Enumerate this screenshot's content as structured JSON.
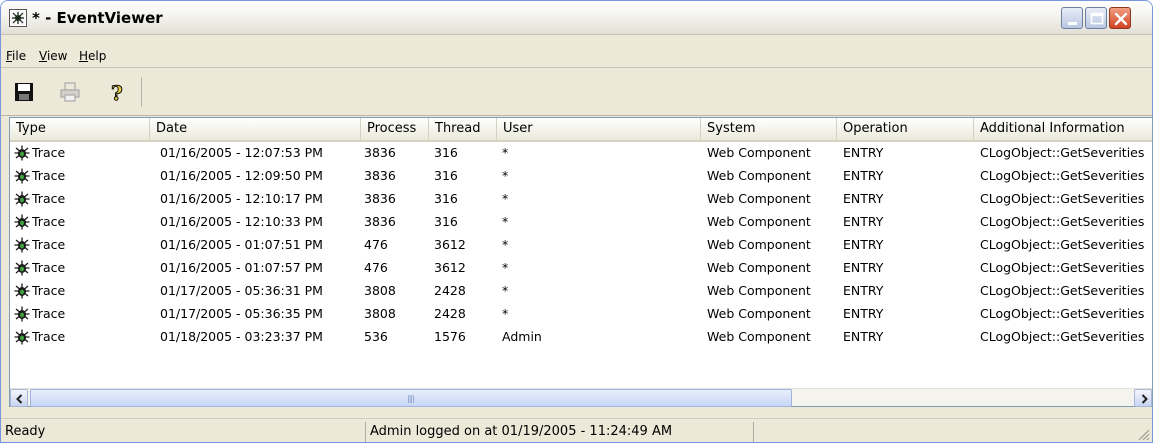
{
  "window": {
    "title": "* - EventViewer",
    "controls": {
      "minimize": "minimize",
      "maximize": "maximize",
      "close": "close"
    }
  },
  "menu": {
    "items": [
      {
        "label": "File",
        "mnemonic": "F",
        "rest": "ile"
      },
      {
        "label": "View",
        "mnemonic": "V",
        "rest": "iew"
      },
      {
        "label": "Help",
        "mnemonic": "H",
        "rest": "elp"
      }
    ]
  },
  "toolbar": {
    "buttons": [
      {
        "icon": "save-icon",
        "enabled": true
      },
      {
        "icon": "print-icon",
        "enabled": false
      },
      {
        "icon": "help-icon",
        "enabled": true
      }
    ]
  },
  "table": {
    "columns": [
      "Type",
      "Date",
      "Process",
      "Thread",
      "User",
      "System",
      "Operation",
      "Additional Information"
    ],
    "rows": [
      [
        "Trace",
        "01/16/2005 - 12:07:53 PM",
        "3836",
        "316",
        "*",
        "Web Component",
        "ENTRY",
        "CLogObject::GetSeverities"
      ],
      [
        "Trace",
        "01/16/2005 - 12:09:50 PM",
        "3836",
        "316",
        "*",
        "Web Component",
        "ENTRY",
        "CLogObject::GetSeverities"
      ],
      [
        "Trace",
        "01/16/2005 - 12:10:17 PM",
        "3836",
        "316",
        "*",
        "Web Component",
        "ENTRY",
        "CLogObject::GetSeverities"
      ],
      [
        "Trace",
        "01/16/2005 - 12:10:33 PM",
        "3836",
        "316",
        "*",
        "Web Component",
        "ENTRY",
        "CLogObject::GetSeverities"
      ],
      [
        "Trace",
        "01/16/2005 - 01:07:51 PM",
        "476",
        "3612",
        "*",
        "Web Component",
        "ENTRY",
        "CLogObject::GetSeverities"
      ],
      [
        "Trace",
        "01/16/2005 - 01:07:57 PM",
        "476",
        "3612",
        "*",
        "Web Component",
        "ENTRY",
        "CLogObject::GetSeverities"
      ],
      [
        "Trace",
        "01/17/2005 - 05:36:31 PM",
        "3808",
        "2428",
        "*",
        "Web Component",
        "ENTRY",
        "CLogObject::GetSeverities"
      ],
      [
        "Trace",
        "01/17/2005 - 05:36:35 PM",
        "3808",
        "2428",
        "*",
        "Web Component",
        "ENTRY",
        "CLogObject::GetSeverities"
      ],
      [
        "Trace",
        "01/18/2005 - 03:23:37 PM",
        "536",
        "1576",
        "Admin",
        "Web Component",
        "ENTRY",
        "CLogObject::GetSeverities"
      ]
    ]
  },
  "status": {
    "ready": "Ready",
    "login": "Admin logged on at 01/19/2005 - 11:24:49 AM",
    "extra": ""
  },
  "colors": {
    "trace_icon": "#1a1a1a",
    "trace_icon_accent": "#3fa33f"
  }
}
